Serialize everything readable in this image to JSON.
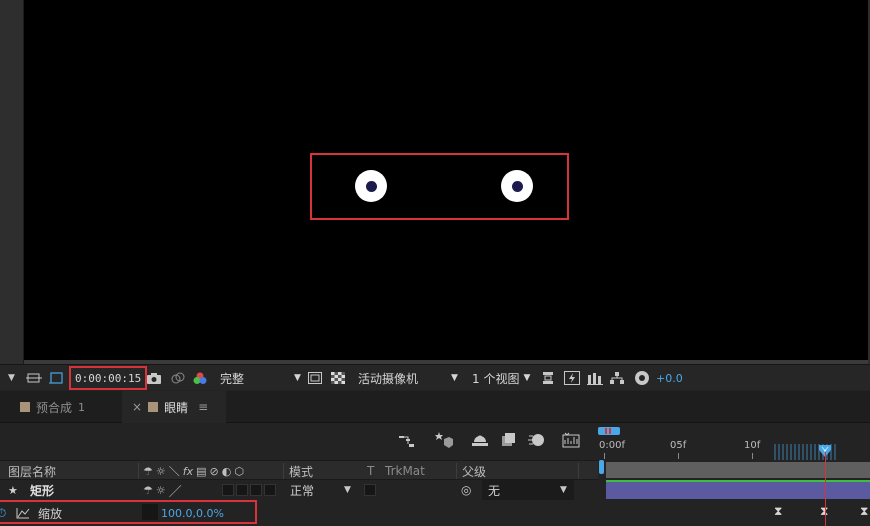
{
  "viewer": {
    "timecode": "0:00:00:15",
    "resolution": "完整",
    "camera": "活动摄像机",
    "views": "1 个视图",
    "exposure": "+0.0"
  },
  "tabs": [
    {
      "label": "预合成",
      "num": "1"
    },
    {
      "label": "眼睛"
    }
  ],
  "tab_close": "×",
  "tab_menu": "≡",
  "columns": {
    "layer_name": "图层名称",
    "mode": "模式",
    "t": "T",
    "trkmat": "TrkMat",
    "parent": "父级"
  },
  "layer": {
    "name": "矩形",
    "mode": "正常",
    "parent": "无"
  },
  "property": {
    "name": "缩放",
    "value": "100.0,0.0%"
  },
  "ruler": {
    "labels": [
      "0:00f",
      "05f",
      "10f"
    ]
  },
  "colors": {
    "highlight": "#d8323a",
    "accent": "#4aa7e8",
    "layer_bar": "#5b5aa0",
    "tab_swatch": "#a99379"
  }
}
